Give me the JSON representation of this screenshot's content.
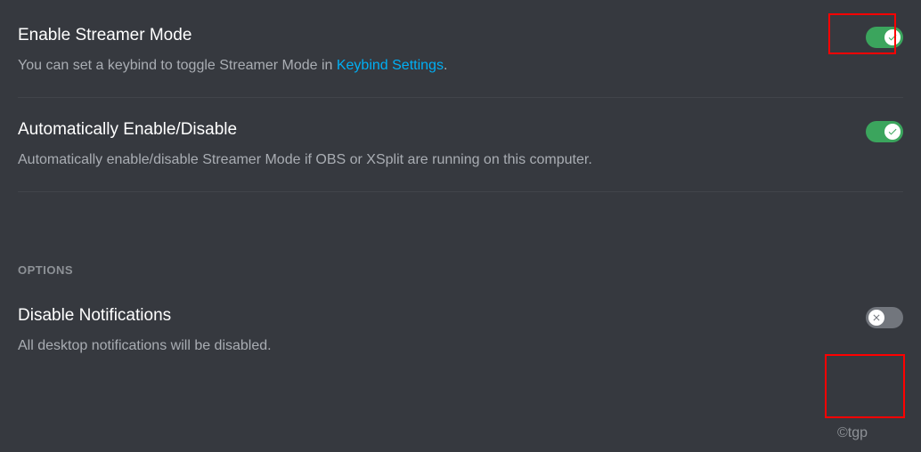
{
  "settings": [
    {
      "title": "Enable Streamer Mode",
      "desc_prefix": "You can set a keybind to toggle Streamer Mode in ",
      "link_text": "Keybind Settings",
      "desc_suffix": ".",
      "enabled": true,
      "highlight": true
    },
    {
      "title": "Automatically Enable/Disable",
      "desc_prefix": "Automatically enable/disable Streamer Mode if OBS or XSplit are running on this computer.",
      "link_text": "",
      "desc_suffix": "",
      "enabled": true,
      "highlight": false
    },
    {
      "title": "Disable Notifications",
      "desc_prefix": "All desktop notifications will be disabled.",
      "link_text": "",
      "desc_suffix": "",
      "enabled": false,
      "highlight": true
    }
  ],
  "section_header": "OPTIONS",
  "watermark": "©tgp"
}
